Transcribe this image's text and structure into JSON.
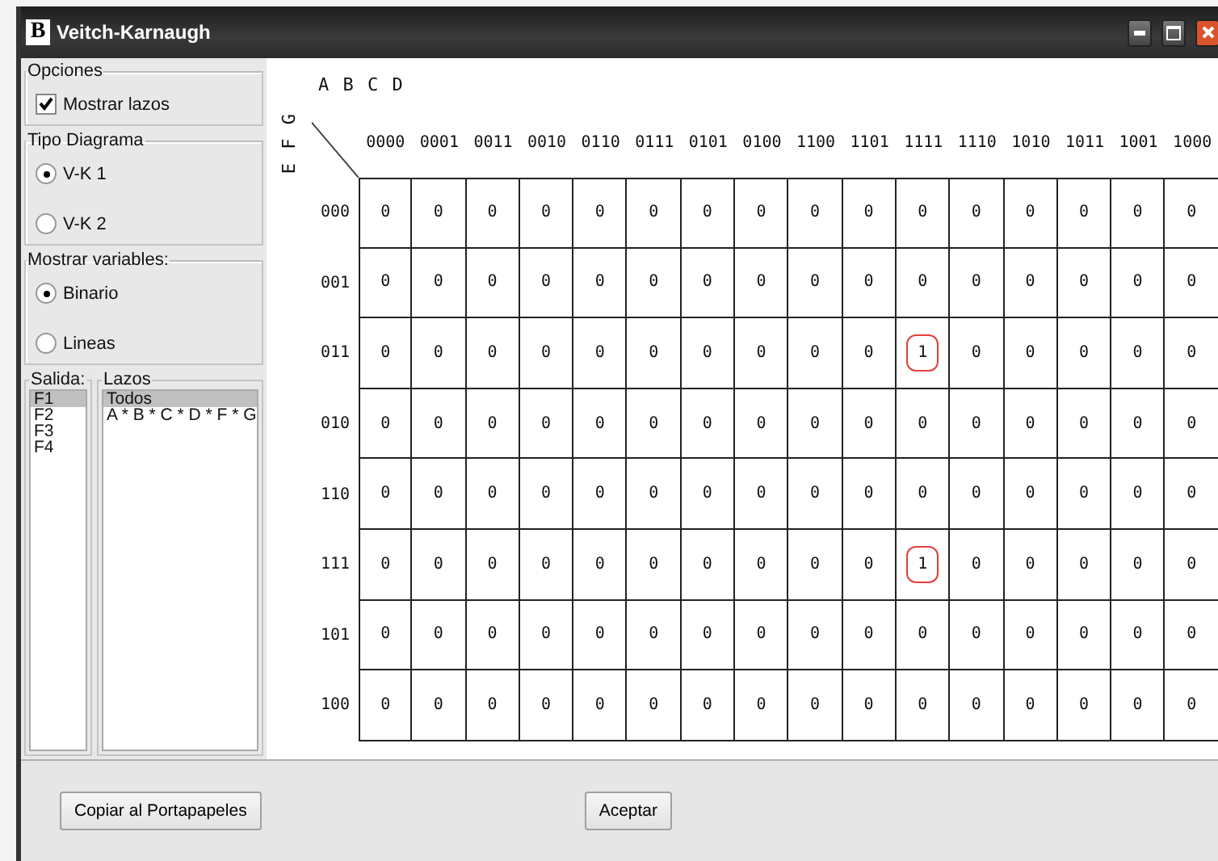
{
  "window": {
    "icon_letter": "B",
    "title": "Veitch-Karnaugh"
  },
  "options": {
    "title": "Opciones",
    "show_loops": {
      "label": "Mostrar lazos",
      "checked": true
    }
  },
  "diagram_type": {
    "title": "Tipo Diagrama",
    "options": [
      {
        "label": "V-K 1",
        "selected": true
      },
      {
        "label": "V-K 2",
        "selected": false
      }
    ]
  },
  "show_variables": {
    "title": "Mostrar variables:",
    "options": [
      {
        "label": "Binario",
        "selected": true
      },
      {
        "label": "Lineas",
        "selected": false
      }
    ]
  },
  "output": {
    "title": "Salida:",
    "items": [
      {
        "label": "F1",
        "selected": true
      },
      {
        "label": "F2",
        "selected": false
      },
      {
        "label": "F3",
        "selected": false
      },
      {
        "label": "F4",
        "selected": false
      }
    ]
  },
  "loops": {
    "title": "Lazos",
    "items": [
      {
        "label": "Todos",
        "selected": true
      },
      {
        "label": "A * B * C * D * F * G",
        "selected": false
      }
    ]
  },
  "map": {
    "column_variables": "A B C D",
    "row_variables": "E F G",
    "columns": [
      "0000",
      "0001",
      "0011",
      "0010",
      "0110",
      "0111",
      "0101",
      "0100",
      "1100",
      "1101",
      "1111",
      "1110",
      "1010",
      "1011",
      "1001",
      "1000"
    ],
    "rows": [
      {
        "label": "000",
        "cells": [
          {
            "value": "0",
            "looped": false
          },
          {
            "value": "0",
            "looped": false
          },
          {
            "value": "0",
            "looped": false
          },
          {
            "value": "0",
            "looped": false
          },
          {
            "value": "0",
            "looped": false
          },
          {
            "value": "0",
            "looped": false
          },
          {
            "value": "0",
            "looped": false
          },
          {
            "value": "0",
            "looped": false
          },
          {
            "value": "0",
            "looped": false
          },
          {
            "value": "0",
            "looped": false
          },
          {
            "value": "0",
            "looped": false
          },
          {
            "value": "0",
            "looped": false
          },
          {
            "value": "0",
            "looped": false
          },
          {
            "value": "0",
            "looped": false
          },
          {
            "value": "0",
            "looped": false
          },
          {
            "value": "0",
            "looped": false
          }
        ]
      },
      {
        "label": "001",
        "cells": [
          {
            "value": "0",
            "looped": false
          },
          {
            "value": "0",
            "looped": false
          },
          {
            "value": "0",
            "looped": false
          },
          {
            "value": "0",
            "looped": false
          },
          {
            "value": "0",
            "looped": false
          },
          {
            "value": "0",
            "looped": false
          },
          {
            "value": "0",
            "looped": false
          },
          {
            "value": "0",
            "looped": false
          },
          {
            "value": "0",
            "looped": false
          },
          {
            "value": "0",
            "looped": false
          },
          {
            "value": "0",
            "looped": false
          },
          {
            "value": "0",
            "looped": false
          },
          {
            "value": "0",
            "looped": false
          },
          {
            "value": "0",
            "looped": false
          },
          {
            "value": "0",
            "looped": false
          },
          {
            "value": "0",
            "looped": false
          }
        ]
      },
      {
        "label": "011",
        "cells": [
          {
            "value": "0",
            "looped": false
          },
          {
            "value": "0",
            "looped": false
          },
          {
            "value": "0",
            "looped": false
          },
          {
            "value": "0",
            "looped": false
          },
          {
            "value": "0",
            "looped": false
          },
          {
            "value": "0",
            "looped": false
          },
          {
            "value": "0",
            "looped": false
          },
          {
            "value": "0",
            "looped": false
          },
          {
            "value": "0",
            "looped": false
          },
          {
            "value": "0",
            "looped": false
          },
          {
            "value": "1",
            "looped": true
          },
          {
            "value": "0",
            "looped": false
          },
          {
            "value": "0",
            "looped": false
          },
          {
            "value": "0",
            "looped": false
          },
          {
            "value": "0",
            "looped": false
          },
          {
            "value": "0",
            "looped": false
          }
        ]
      },
      {
        "label": "010",
        "cells": [
          {
            "value": "0",
            "looped": false
          },
          {
            "value": "0",
            "looped": false
          },
          {
            "value": "0",
            "looped": false
          },
          {
            "value": "0",
            "looped": false
          },
          {
            "value": "0",
            "looped": false
          },
          {
            "value": "0",
            "looped": false
          },
          {
            "value": "0",
            "looped": false
          },
          {
            "value": "0",
            "looped": false
          },
          {
            "value": "0",
            "looped": false
          },
          {
            "value": "0",
            "looped": false
          },
          {
            "value": "0",
            "looped": false
          },
          {
            "value": "0",
            "looped": false
          },
          {
            "value": "0",
            "looped": false
          },
          {
            "value": "0",
            "looped": false
          },
          {
            "value": "0",
            "looped": false
          },
          {
            "value": "0",
            "looped": false
          }
        ]
      },
      {
        "label": "110",
        "cells": [
          {
            "value": "0",
            "looped": false
          },
          {
            "value": "0",
            "looped": false
          },
          {
            "value": "0",
            "looped": false
          },
          {
            "value": "0",
            "looped": false
          },
          {
            "value": "0",
            "looped": false
          },
          {
            "value": "0",
            "looped": false
          },
          {
            "value": "0",
            "looped": false
          },
          {
            "value": "0",
            "looped": false
          },
          {
            "value": "0",
            "looped": false
          },
          {
            "value": "0",
            "looped": false
          },
          {
            "value": "0",
            "looped": false
          },
          {
            "value": "0",
            "looped": false
          },
          {
            "value": "0",
            "looped": false
          },
          {
            "value": "0",
            "looped": false
          },
          {
            "value": "0",
            "looped": false
          },
          {
            "value": "0",
            "looped": false
          }
        ]
      },
      {
        "label": "111",
        "cells": [
          {
            "value": "0",
            "looped": false
          },
          {
            "value": "0",
            "looped": false
          },
          {
            "value": "0",
            "looped": false
          },
          {
            "value": "0",
            "looped": false
          },
          {
            "value": "0",
            "looped": false
          },
          {
            "value": "0",
            "looped": false
          },
          {
            "value": "0",
            "looped": false
          },
          {
            "value": "0",
            "looped": false
          },
          {
            "value": "0",
            "looped": false
          },
          {
            "value": "0",
            "looped": false
          },
          {
            "value": "1",
            "looped": true
          },
          {
            "value": "0",
            "looped": false
          },
          {
            "value": "0",
            "looped": false
          },
          {
            "value": "0",
            "looped": false
          },
          {
            "value": "0",
            "looped": false
          },
          {
            "value": "0",
            "looped": false
          }
        ]
      },
      {
        "label": "101",
        "cells": [
          {
            "value": "0",
            "looped": false
          },
          {
            "value": "0",
            "looped": false
          },
          {
            "value": "0",
            "looped": false
          },
          {
            "value": "0",
            "looped": false
          },
          {
            "value": "0",
            "looped": false
          },
          {
            "value": "0",
            "looped": false
          },
          {
            "value": "0",
            "looped": false
          },
          {
            "value": "0",
            "looped": false
          },
          {
            "value": "0",
            "looped": false
          },
          {
            "value": "0",
            "looped": false
          },
          {
            "value": "0",
            "looped": false
          },
          {
            "value": "0",
            "looped": false
          },
          {
            "value": "0",
            "looped": false
          },
          {
            "value": "0",
            "looped": false
          },
          {
            "value": "0",
            "looped": false
          },
          {
            "value": "0",
            "looped": false
          }
        ]
      },
      {
        "label": "100",
        "cells": [
          {
            "value": "0",
            "looped": false
          },
          {
            "value": "0",
            "looped": false
          },
          {
            "value": "0",
            "looped": false
          },
          {
            "value": "0",
            "looped": false
          },
          {
            "value": "0",
            "looped": false
          },
          {
            "value": "0",
            "looped": false
          },
          {
            "value": "0",
            "looped": false
          },
          {
            "value": "0",
            "looped": false
          },
          {
            "value": "0",
            "looped": false
          },
          {
            "value": "0",
            "looped": false
          },
          {
            "value": "0",
            "looped": false
          },
          {
            "value": "0",
            "looped": false
          },
          {
            "value": "0",
            "looped": false
          },
          {
            "value": "0",
            "looped": false
          },
          {
            "value": "0",
            "looped": false
          },
          {
            "value": "0",
            "looped": false
          }
        ]
      }
    ]
  },
  "buttons": [
    {
      "label": "Copiar al Portapapeles"
    },
    {
      "label": "Aceptar"
    }
  ]
}
